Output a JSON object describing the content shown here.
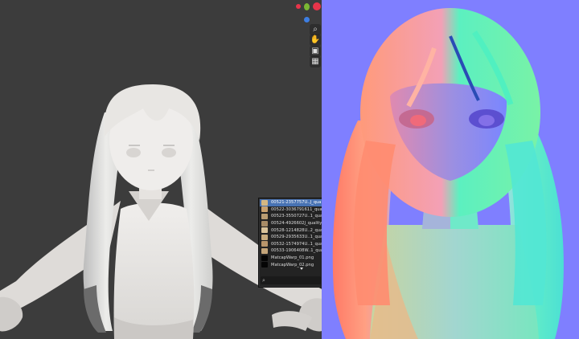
{
  "viewport_left": {
    "background": "#3c3c3c",
    "model_color": "#e9e6e2"
  },
  "viewport_right": {
    "background": "#7f7fff"
  },
  "gizmo": {
    "axis_x_color": "#e8344a",
    "axis_y_color": "#7bb733",
    "axis_z_color": "#3d7ee2"
  },
  "nav": {
    "zoom_icon": "zoom-icon",
    "pan_icon": "pan-hand-icon",
    "camera_icon": "camera-icon",
    "ortho_icon": "grid-ortho-icon"
  },
  "matcap_panel": {
    "items": [
      {
        "label": "00521-2357757U..J_quality",
        "selected": true
      },
      {
        "label": "00522-3036791611_quality",
        "selected": false
      },
      {
        "label": "00523-3550727U..1_quality",
        "selected": false
      },
      {
        "label": "00524-4926602J_quality",
        "selected": false
      },
      {
        "label": "00528-1214828U..2_quality",
        "selected": false
      },
      {
        "label": "00529-2935633U..1_quality",
        "selected": false
      },
      {
        "label": "00532-1574974U..1_quality",
        "selected": false
      },
      {
        "label": "00533-1906408W..1_quality",
        "selected": false
      },
      {
        "label": "MatcapWarp_01.png",
        "selected": false
      },
      {
        "label": "MatcapWarp_02.png",
        "selected": false
      }
    ],
    "search_icon": "search-icon"
  }
}
